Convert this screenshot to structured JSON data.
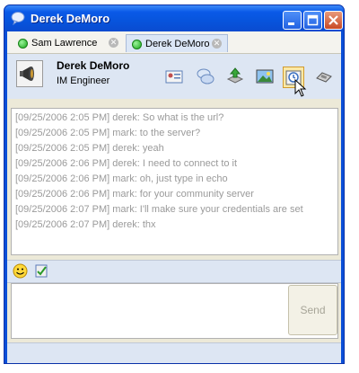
{
  "window": {
    "title": "Derek DeMoro"
  },
  "tabs": [
    {
      "label": "Sam Lawrence",
      "status": "online",
      "active": false
    },
    {
      "label": "Derek DeMoro",
      "status": "online",
      "active": true
    }
  ],
  "contact": {
    "name": "Derek DeMoro",
    "status": "IM Engineer"
  },
  "toolbar": {
    "icons": [
      "contact-card-icon",
      "chat-bubbles-icon",
      "send-file-icon",
      "picture-icon",
      "history-icon",
      "phone-icon"
    ]
  },
  "chat": {
    "messages": [
      {
        "text": "[09/25/2006 2:05 PM]  derek: So what is the url?"
      },
      {
        "text": "[09/25/2006 2:05 PM]  mark: to the server?"
      },
      {
        "text": "[09/25/2006 2:05 PM]  derek: yeah"
      },
      {
        "text": "[09/25/2006 2:06 PM]  derek: I need to connect to it"
      },
      {
        "text": "[09/25/2006 2:06 PM]  mark: oh, just type in echo"
      },
      {
        "text": "[09/25/2006 2:06 PM]  mark: for your community server"
      },
      {
        "text": "[09/25/2006 2:07 PM]  mark: I'll make sure your credentials are set"
      },
      {
        "text": "[09/25/2006 2:07 PM]  derek: thx"
      }
    ]
  },
  "compose": {
    "value": "",
    "send_label": "Send"
  },
  "colors": {
    "title_bar": "#0a5ae8",
    "header_bg": "#dde6f3",
    "message_text": "#9a9a9a",
    "highlight": "#fbe9a6"
  }
}
